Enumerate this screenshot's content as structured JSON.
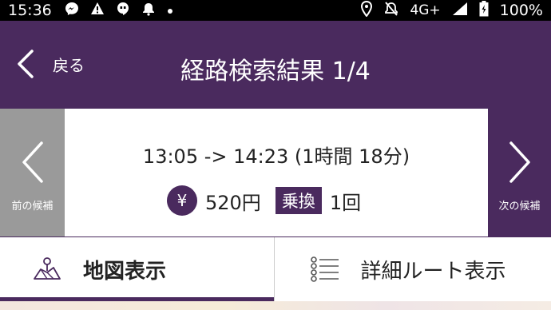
{
  "status_bar": {
    "time": "15:36",
    "network": "4G+",
    "battery": "100%",
    "notification_icons": [
      "messenger-icon",
      "alert-icon",
      "hangouts-icon",
      "bell-icon",
      "dot-icon"
    ]
  },
  "header": {
    "back_label": "戻る",
    "title": "経路検索結果 1/4"
  },
  "nav": {
    "prev_label": "前の候補",
    "next_label": "次の候補"
  },
  "summary": {
    "times": "13:05 -> 14:23 (1時間 18分)",
    "yen_symbol": "¥",
    "fare": "520円",
    "transfer_label": "乗換",
    "transfer_count": "1回"
  },
  "tabs": {
    "map_label": "地図表示",
    "detail_label": "詳細ルート表示"
  },
  "colors": {
    "primary": "#4a2a5e",
    "prev_disabled": "#9a9a9a"
  }
}
